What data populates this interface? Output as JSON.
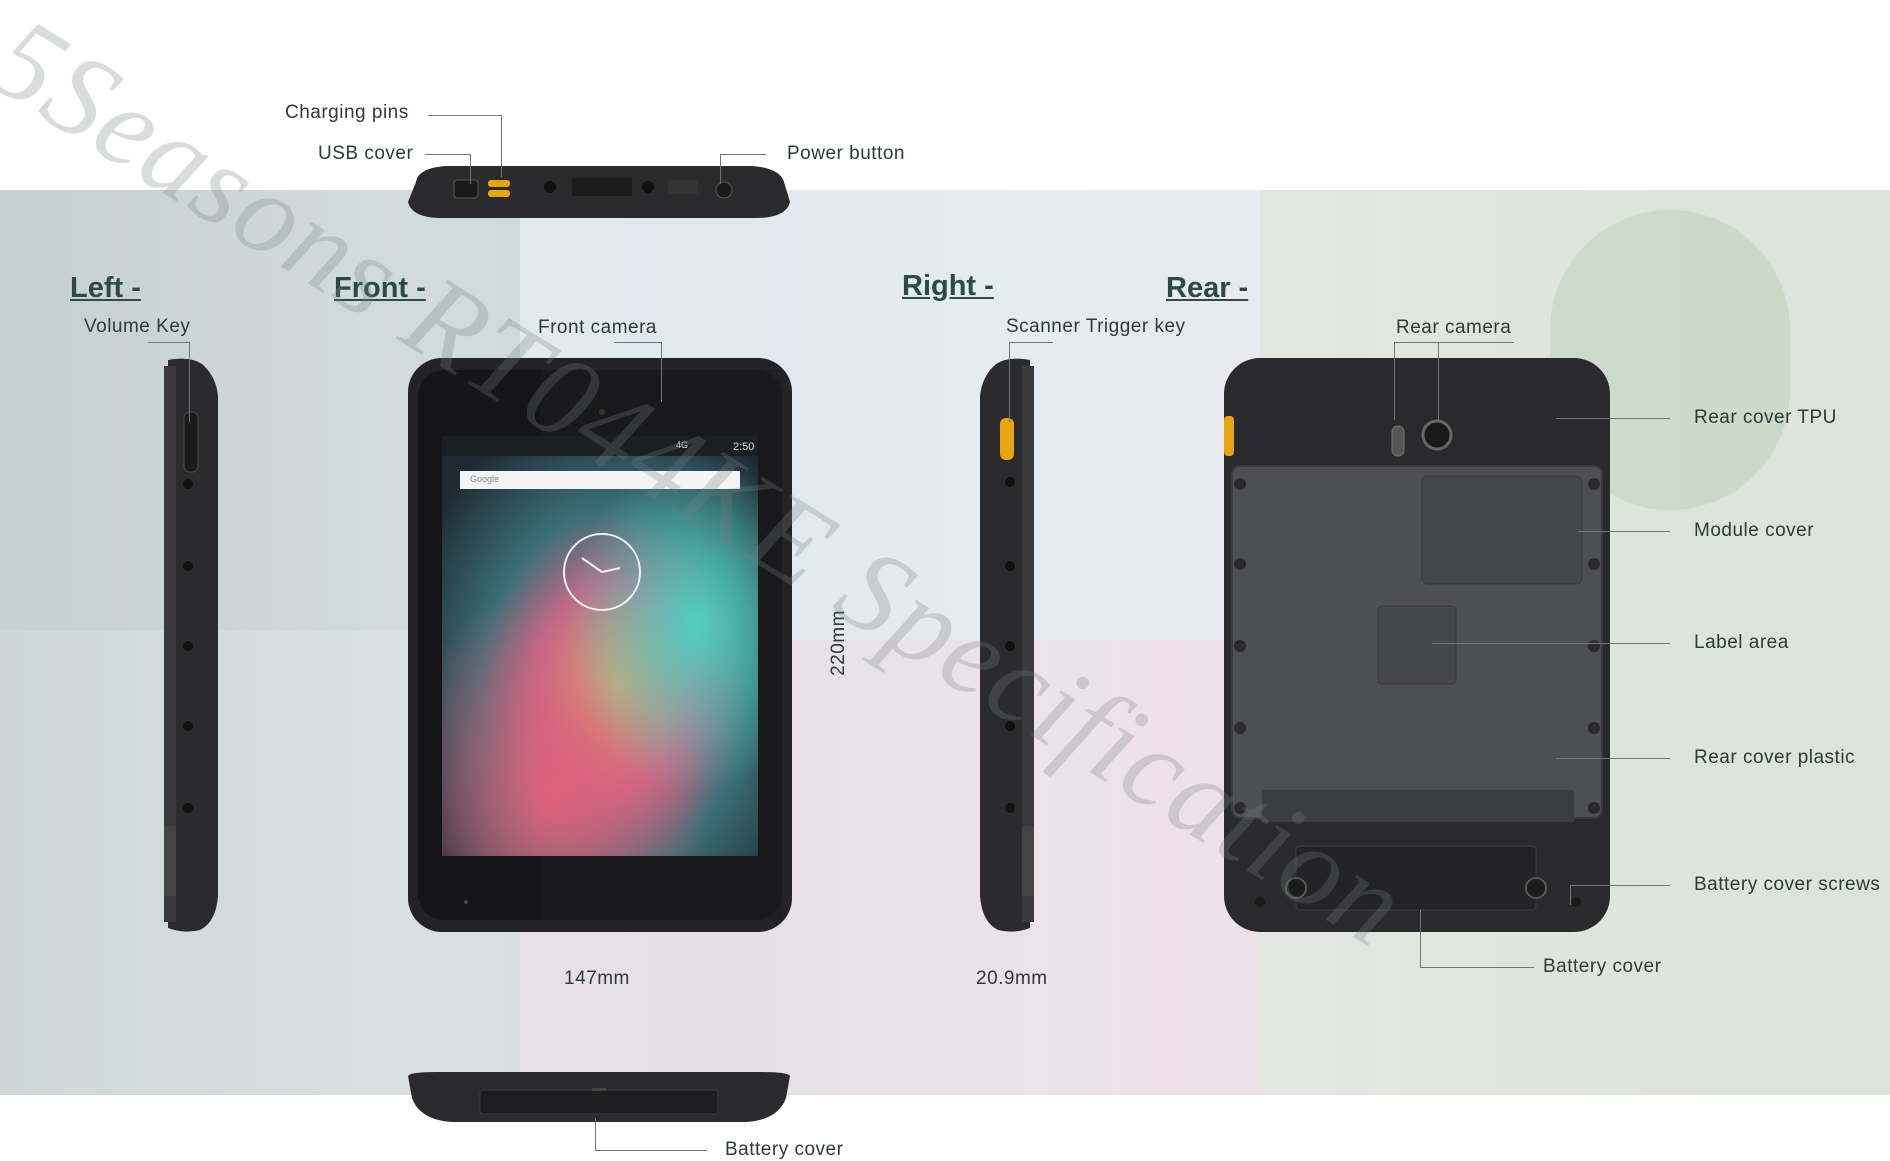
{
  "watermark": "5Seasons RT044KE Specification",
  "headers": {
    "left": "Left -",
    "front": "Front -",
    "right": "Right -",
    "rear": "Rear -"
  },
  "labels": {
    "charging_pins": "Charging pins",
    "usb_cover": "USB cover",
    "power_button": "Power button",
    "volume_key": "Volume Key",
    "front_camera": "Front camera",
    "scanner_trigger_key": "Scanner Trigger key",
    "rear_camera": "Rear camera",
    "rear_cover_tpu": "Rear cover TPU",
    "module_cover": "Module cover",
    "label_area": "Label area",
    "rear_cover_plastic": "Rear cover plastic",
    "battery_cover_screws": "Battery cover screws",
    "battery_cover_rear": "Battery cover",
    "battery_cover_bottom": "Battery cover"
  },
  "dimensions": {
    "height": "220mm",
    "width": "147mm",
    "depth": "20.9mm"
  },
  "screen": {
    "status_time": "2:50",
    "status_network": "4G",
    "search_brand": "Google"
  },
  "colors": {
    "device_body": "#2b2b2d",
    "accent_yellow": "#e8a512",
    "header_text": "#2c4a46"
  }
}
